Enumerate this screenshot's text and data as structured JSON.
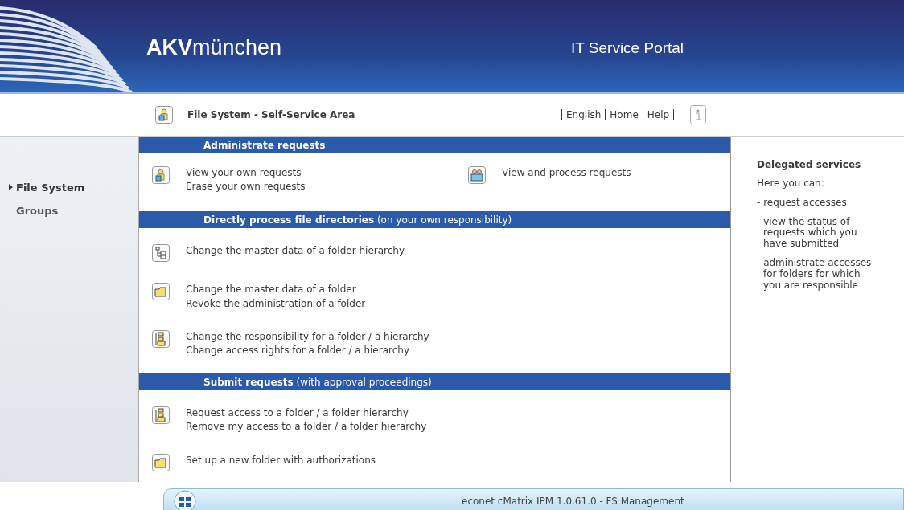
{
  "header": {
    "brand_bold": "AKV",
    "brand_rest": "münchen",
    "portal_title": "IT Service Portal"
  },
  "nav": {
    "title": "File System - Self-Service Area",
    "links": [
      "English",
      "Home",
      "Help"
    ]
  },
  "sidebar": {
    "items": [
      {
        "label": "File System",
        "selected": true
      },
      {
        "label": "Groups",
        "selected": false
      }
    ]
  },
  "sections": [
    {
      "title": "Administrate requests",
      "kind": "columns",
      "groups": [
        {
          "kind": "user",
          "links": [
            "View your own requests",
            "Erase your own requests"
          ]
        },
        {
          "kind": "users",
          "links": [
            "View and process requests"
          ]
        }
      ]
    },
    {
      "title": "Directly process file directories",
      "note": "(on your own responsibility)",
      "kind": "rows",
      "groups": [
        {
          "kind": "tree",
          "links": [
            "Change the master data of a folder hierarchy"
          ]
        },
        {
          "kind": "folder",
          "links": [
            "Change the master data of a folder",
            "Revoke the administration of a folder"
          ]
        },
        {
          "kind": "hierarchy",
          "links": [
            "Change the responsibility for a folder / a hierarchy",
            "Change access rights for a folder / a hierarchy"
          ]
        }
      ]
    },
    {
      "title": "Submit requests",
      "note": "(with approval proceedings)",
      "kind": "rows",
      "groups": [
        {
          "kind": "hierarchy",
          "links": [
            "Request access to a folder / a folder hierarchy",
            "Remove my access to a folder / a folder hierarchy"
          ]
        },
        {
          "kind": "folder",
          "links": [
            "Set up a new folder with authorizations"
          ]
        }
      ]
    }
  ],
  "info": {
    "title": "Delegated services",
    "intro": "Here you can:",
    "items": [
      "- request accesses",
      "- view the status of requests which you have submitted",
      "- administrate accesses for folders for which you are responsible"
    ]
  },
  "footer": {
    "title": "econet cMatrix IPM 1.0.61.0 - FS Management"
  }
}
